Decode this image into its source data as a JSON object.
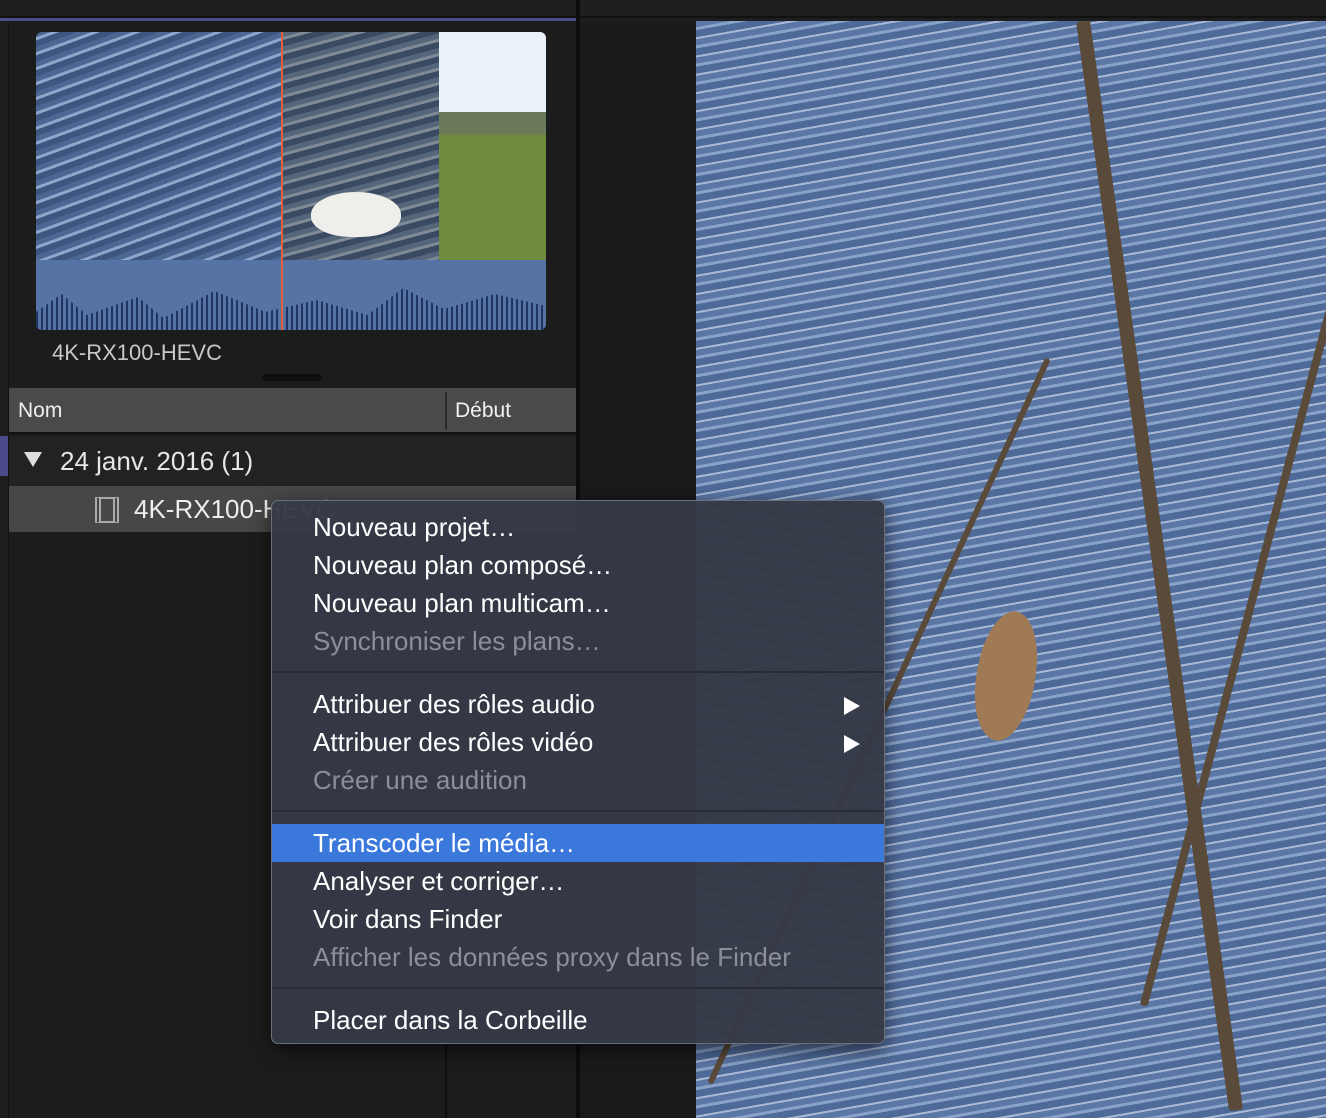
{
  "browser": {
    "clip_title": "4K-RX100-HEVC"
  },
  "list": {
    "columns": {
      "name": "Nom",
      "start": "Début"
    },
    "group": {
      "label": "24 janv. 2016  (1)"
    },
    "clip": {
      "name": "4K-RX100-HEVC"
    }
  },
  "menu": {
    "section1": [
      "Nouveau projet…",
      "Nouveau plan composé…",
      "Nouveau plan multicam…",
      "Synchroniser les plans…"
    ],
    "section2": [
      "Attribuer des rôles audio",
      "Attribuer des rôles vidéo",
      "Créer une audition"
    ],
    "section3": [
      "Transcoder le média…",
      "Analyser et corriger…",
      "Voir dans Finder",
      "Afficher les données proxy dans le Finder"
    ],
    "section4": [
      "Placer dans la Corbeille"
    ]
  },
  "colors": {
    "highlight": "#3b78dc",
    "playhead": "#e0603a",
    "accent": "#4b4a8a"
  }
}
